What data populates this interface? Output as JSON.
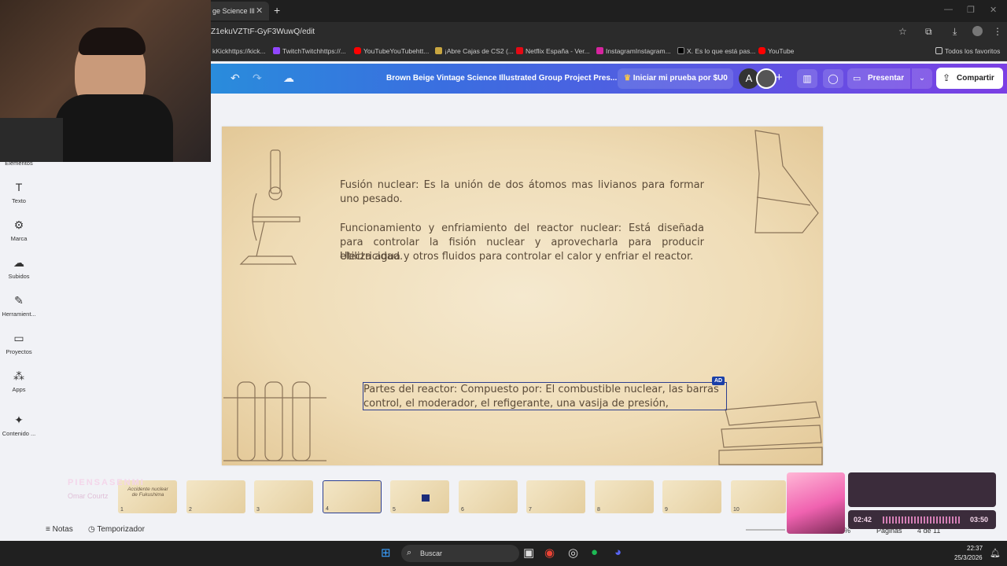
{
  "browser": {
    "tab_title": "ge Science Ill",
    "url": "Z1ekuVZTtF-GyF3WuwQ/edit",
    "bookmarks": [
      {
        "label": "kKickhttps://kick..."
      },
      {
        "label": "TwitchTwitchhttps://..."
      },
      {
        "label": "YouTubeYouTubehtt..."
      },
      {
        "label": "¡Abre Cajas de CS2 (..."
      },
      {
        "label": "Netflix España - Ver..."
      },
      {
        "label": "InstagramInstagram..."
      },
      {
        "label": "X. Es lo que está pas..."
      },
      {
        "label": "YouTube"
      }
    ],
    "all_favorites": "Todos los favoritos"
  },
  "canva": {
    "doc_title": "Brown Beige Vintage Science Illustrated Group Project Pres...",
    "trial_button": "Iniciar mi prueba por $U0",
    "avatar_letter": "A",
    "present_button": "Presentar",
    "share_button": "Compartir"
  },
  "sidebar": {
    "items": [
      {
        "label": "Elementos",
        "icon": "elements-icon"
      },
      {
        "label": "Texto",
        "icon": "T"
      },
      {
        "label": "Marca",
        "icon": "brand-icon"
      },
      {
        "label": "Subidos",
        "icon": "upload-icon"
      },
      {
        "label": "Herramient...",
        "icon": "tools-icon"
      },
      {
        "label": "Proyectos",
        "icon": "folder-icon"
      },
      {
        "label": "Apps",
        "icon": "apps-icon"
      },
      {
        "label": "Contenido ...",
        "icon": "magic-icon"
      }
    ]
  },
  "slide": {
    "para1": "Fusión nuclear: Es la unión de dos átomos mas livianos para formar uno pesado.",
    "para2": "Funcionamiento y enfriamiento del reactor nuclear: Está diseñada para controlar la fisión nuclear y aprovecharla para producir electricidad.",
    "para3": "Utiliza agua y otros fluidos para controlar el calor y enfriar el reactor.",
    "para4": "Partes del reactor: Compuesto por: El combustible nuclear, las barras control, el moderador, el refigerante, una vasija de presión,",
    "badge": "AD"
  },
  "thumbnails": [
    {
      "num": "1",
      "title": "Accidente nuclear de Fukushima"
    },
    {
      "num": "2",
      "title": ""
    },
    {
      "num": "3",
      "title": ""
    },
    {
      "num": "4",
      "title": ""
    },
    {
      "num": "5",
      "title": ""
    },
    {
      "num": "6",
      "title": ""
    },
    {
      "num": "7",
      "title": ""
    },
    {
      "num": "8",
      "title": ""
    },
    {
      "num": "9",
      "title": ""
    },
    {
      "num": "10",
      "title": ""
    }
  ],
  "bottom": {
    "notes": "Notas",
    "timer": "Temporizador",
    "zoom": "60%",
    "pages": "Páginas",
    "page_of": "4 de 11"
  },
  "music": {
    "title": "PIENSASENMI",
    "artist": "Omar Courtz",
    "time_current": "02:42",
    "time_total": "03:50"
  },
  "taskbar": {
    "search": "Buscar",
    "time": "22:37",
    "date": "25/3/2026"
  }
}
